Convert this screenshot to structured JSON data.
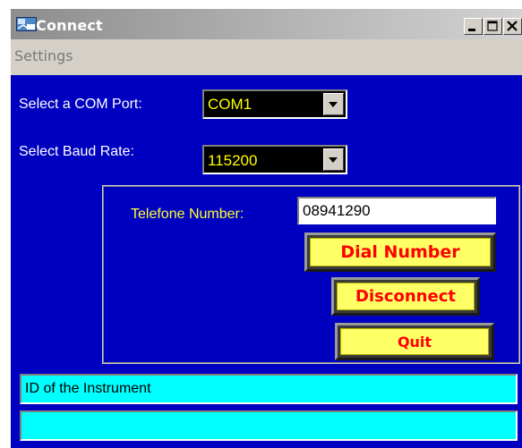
{
  "window": {
    "title": "Connect",
    "controls": [
      "minimize-icon",
      "maximize-icon",
      "close-icon"
    ]
  },
  "menu": {
    "items": [
      {
        "label": "Settings"
      }
    ]
  },
  "com_port": {
    "label": "Select a COM Port:",
    "value": "COM1"
  },
  "baud_rate": {
    "label": "Select Baud Rate:",
    "value": "115200"
  },
  "telefone": {
    "label": "Telefone Number:",
    "value": "08941290"
  },
  "buttons": {
    "dial": "Dial Number",
    "disconnect": "Disconnect",
    "quit": "Quit"
  },
  "status": {
    "line1": "ID of the Instrument",
    "line2": ""
  },
  "colors": {
    "client_bg": "#0000c0",
    "label_white": "#ffffff",
    "label_yellow": "#ffff33",
    "button_face": "#ffff66",
    "button_text": "#ff0000",
    "status_bg": "#00ffff"
  }
}
